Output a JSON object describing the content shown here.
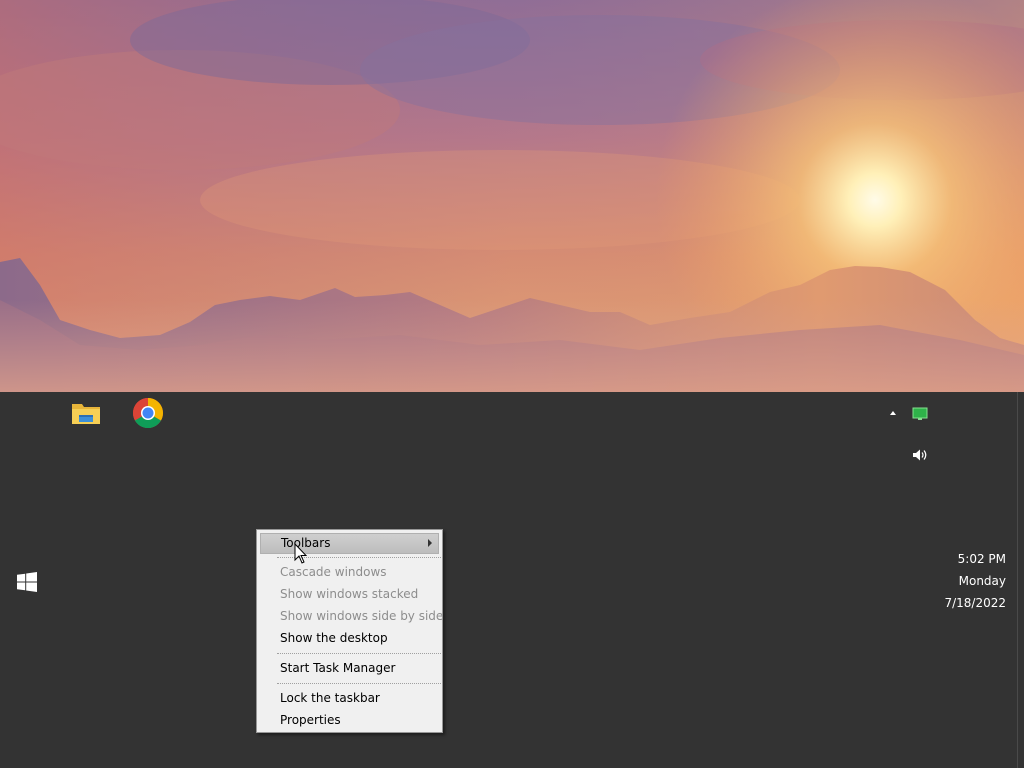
{
  "desktop": {
    "wallpaper_icon": "sunset-mountains-wallpaper"
  },
  "taskbar": {
    "start_icon": "windows-logo-icon",
    "pinned_apps": [
      {
        "name": "File Explorer",
        "icon": "folder-icon"
      },
      {
        "name": "Google Chrome",
        "icon": "chrome-icon"
      }
    ],
    "tray": {
      "chevron_icon": "chevron-up-icon",
      "network_icon": "monitor-network-icon",
      "volume_icon": "speaker-icon"
    },
    "clock": {
      "time": "5:02 PM",
      "day": "Monday",
      "date": "7/18/2022"
    }
  },
  "context_menu": {
    "items": [
      {
        "label": "Toolbars",
        "enabled": true,
        "submenu": true,
        "highlighted": true
      },
      {
        "label": "Cascade windows",
        "enabled": false
      },
      {
        "label": "Show windows stacked",
        "enabled": false
      },
      {
        "label": "Show windows side by side",
        "enabled": false
      },
      {
        "label": "Show the desktop",
        "enabled": true
      },
      {
        "label": "Start Task Manager",
        "enabled": true
      },
      {
        "label": "Lock the taskbar",
        "enabled": true
      },
      {
        "label": "Properties",
        "enabled": true
      }
    ]
  },
  "colors": {
    "taskbar": "#333333",
    "menu_background": "#f0f0f0",
    "menu_disabled_text": "#8d8d8d",
    "menu_highlight": "#c4c4c4",
    "network_indicator": "#2fb34a"
  }
}
